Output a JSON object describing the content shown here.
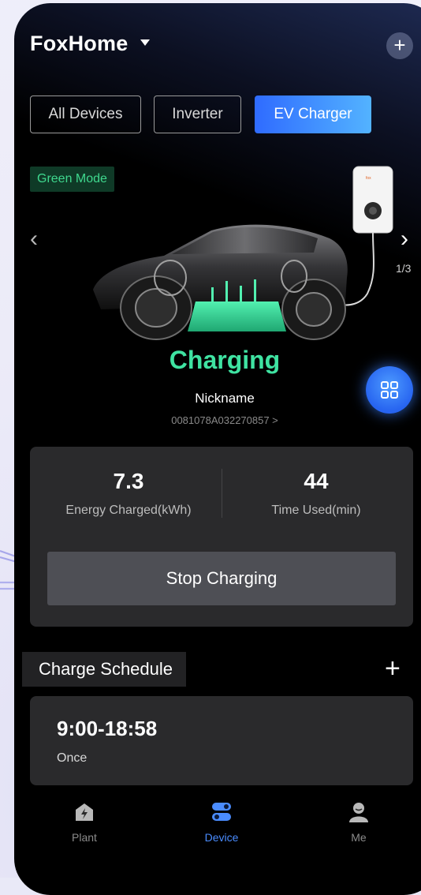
{
  "header": {
    "title": "FoxHome",
    "add_icon": "plus-icon"
  },
  "tabs": [
    {
      "label": "All Devices",
      "active": false
    },
    {
      "label": "Inverter",
      "active": false
    },
    {
      "label": "EV Charger",
      "active": true
    }
  ],
  "charger": {
    "mode_badge": "Green Mode",
    "pager": "1/3",
    "status": "Charging",
    "nickname": "Nickname",
    "serial": "0081078A032270857 >"
  },
  "stats": {
    "energy_value": "7.3",
    "energy_label": "Energy Charged(kWh)",
    "time_value": "44",
    "time_label": "Time Used(min)"
  },
  "actions": {
    "stop_label": "Stop Charging"
  },
  "schedule": {
    "title": "Charge Schedule",
    "items": [
      {
        "time": "9:00-18:58",
        "repeat": "Once"
      }
    ]
  },
  "navbar": [
    {
      "label": "Plant",
      "icon": "plant-icon",
      "active": false
    },
    {
      "label": "Device",
      "icon": "device-icon",
      "active": true
    },
    {
      "label": "Me",
      "icon": "user-icon",
      "active": false
    }
  ],
  "colors": {
    "accent": "#2f6bff",
    "charging_green": "#3fe3a2",
    "card_bg": "#2a2a2c"
  }
}
